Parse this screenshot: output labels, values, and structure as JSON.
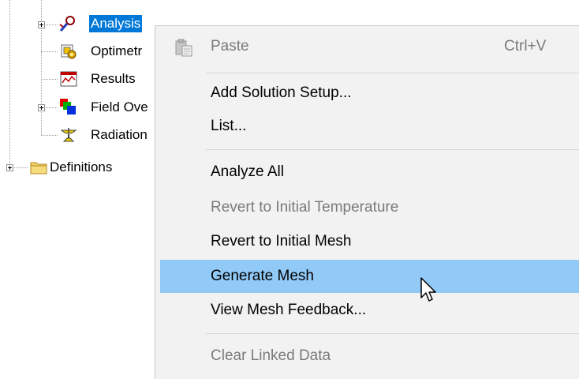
{
  "tree": {
    "items": [
      {
        "label": "Analysis",
        "icon": "analysis-icon",
        "selected": true,
        "expandable": true
      },
      {
        "label": "Optimetr",
        "icon": "optimetrics-icon",
        "selected": false,
        "expandable": false
      },
      {
        "label": "Results",
        "icon": "results-icon",
        "selected": false,
        "expandable": false
      },
      {
        "label": "Field Ove",
        "icon": "field-overlays-icon",
        "selected": false,
        "expandable": true
      },
      {
        "label": "Radiation",
        "icon": "radiation-icon",
        "selected": false,
        "expandable": false
      },
      {
        "label": "Definitions",
        "icon": "folder-icon",
        "selected": false,
        "expandable": true
      }
    ]
  },
  "menu": {
    "items": [
      {
        "label": "Paste",
        "shortcut": "Ctrl+V",
        "enabled": false,
        "icon": "paste-icon"
      },
      {
        "label": "Add Solution Setup...",
        "enabled": true
      },
      {
        "label": "List...",
        "enabled": true
      },
      {
        "label": "Analyze All",
        "enabled": true
      },
      {
        "label": "Revert to Initial Temperature",
        "enabled": false
      },
      {
        "label": "Revert to Initial Mesh",
        "enabled": true
      },
      {
        "label": "Generate Mesh",
        "enabled": true,
        "highlighted": true
      },
      {
        "label": "View Mesh Feedback...",
        "enabled": true
      },
      {
        "label": "Clear Linked Data",
        "enabled": false
      }
    ]
  },
  "colors": {
    "selection": "#0078d7",
    "menu_background": "#f2f2f2",
    "menu_highlight": "#91c9f7",
    "disabled_text": "#7a7a7a"
  }
}
